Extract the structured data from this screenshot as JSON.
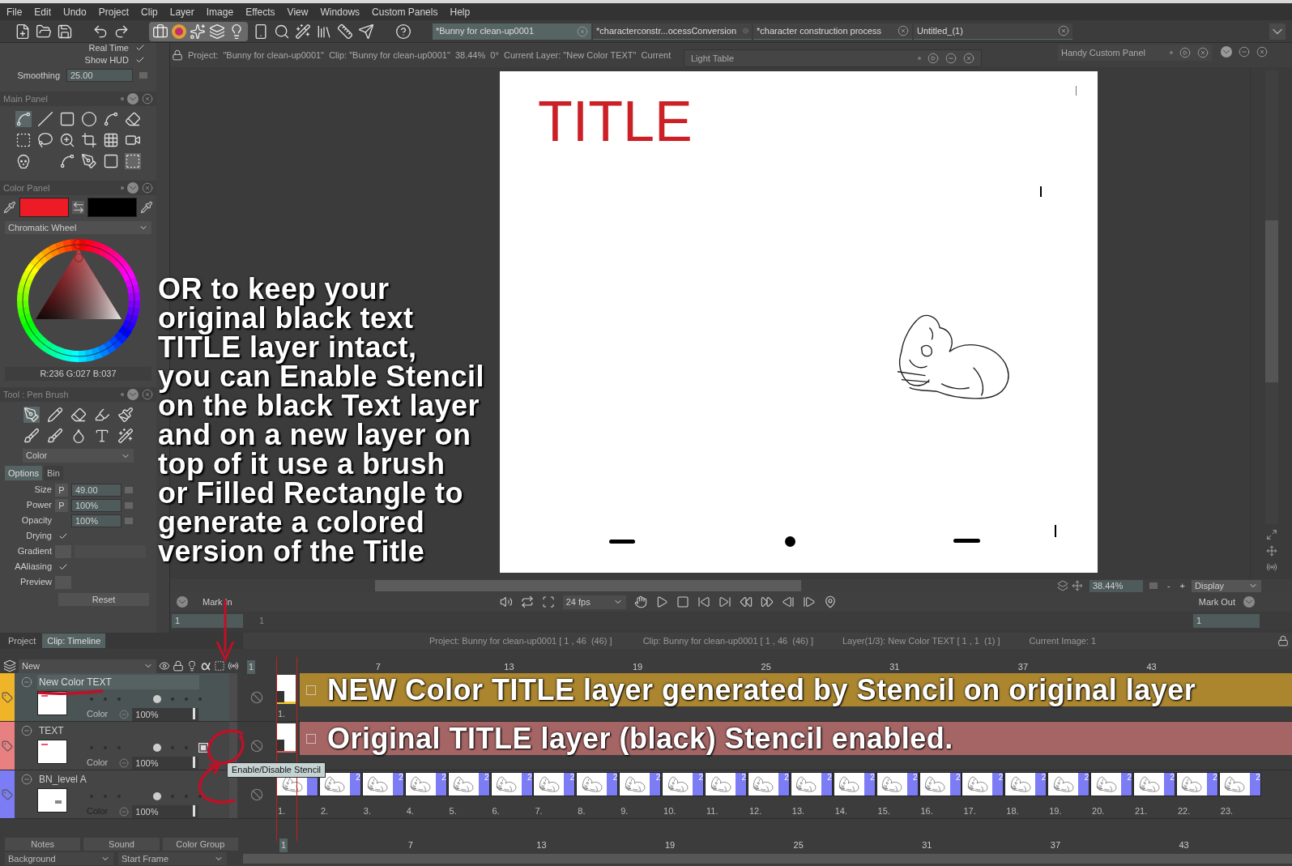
{
  "menu": [
    "File",
    "Edit",
    "Undo",
    "Project",
    "Clip",
    "Layer",
    "Image",
    "Effects",
    "View",
    "Windows",
    "Custom Panels",
    "Help"
  ],
  "project_tabs": [
    {
      "label": "*Bunny for clean-up0001",
      "selected": true
    },
    {
      "label": "*characterconstr...ocessConversion",
      "selected": false
    },
    {
      "label": "*character construction process",
      "selected": false
    },
    {
      "label": "Untitled_(1)",
      "selected": false
    }
  ],
  "info_bar": "Project:  \"Bunny for clean-up0001\"  Clip: \"Bunny for clean-up0001\"  38.44%  0°  Current Layer: \"New Color TEXT\"  Current",
  "light_table": "Light Table",
  "handy_panel": "Handy Custom Panel",
  "tool_options": {
    "rows": [
      {
        "label": "Real Time",
        "checked": true
      },
      {
        "label": "Show HUD",
        "checked": true
      }
    ],
    "smoothing_label": "Smoothing",
    "smoothing_value": "25.00"
  },
  "main_panel": "Main Panel",
  "color_panel": {
    "title": "Color Panel",
    "mode": "Chromatic Wheel",
    "rgb": "R:236 G:027 B:037"
  },
  "tool_panel": {
    "title": "Tool : Pen Brush",
    "mode": "Color",
    "tabs": [
      {
        "label": "Options",
        "selected": true
      },
      {
        "label": "Bin",
        "selected": false
      }
    ],
    "params": [
      {
        "kind": "field",
        "label": "Size",
        "pressure": "P",
        "value": "49.00"
      },
      {
        "kind": "field",
        "label": "Power",
        "pressure": "P",
        "value": "100%"
      },
      {
        "kind": "field",
        "label": "Opacity",
        "value": "100%"
      },
      {
        "kind": "check",
        "label": "Drying",
        "checked": true
      },
      {
        "kind": "gradient",
        "label": "Gradient"
      },
      {
        "kind": "check",
        "label": "AAliasing",
        "checked": true
      },
      {
        "kind": "check",
        "label": "Preview",
        "checked": false
      }
    ],
    "reset": "Reset"
  },
  "canvas": {
    "title": "TITLE"
  },
  "annotation": [
    "OR to keep your",
    "original black text",
    "TITLE layer intact,",
    "you can Enable Stencil",
    "on the black Text layer",
    "and on a new layer on",
    "top of it use a brush",
    "or Filled Rectangle to",
    "generate a colored",
    "version of the Title"
  ],
  "transport": {
    "mark_in": "Mark In",
    "fps": "24 fps",
    "mark_out": "Mark Out",
    "in_value": "1",
    "ruler_label": "1",
    "out_value": "1",
    "zoom": "38.44%",
    "zoom_minus": "-",
    "zoom_plus": "+",
    "display": "Display"
  },
  "timeline": {
    "tabs": [
      {
        "label": "Project",
        "selected": false
      },
      {
        "label": "Clip: Timeline",
        "selected": true
      }
    ],
    "status": [
      "Project: Bunny for clean-up0001 [ 1 , 46  (46) ]",
      "Clip: Bunny for clean-up0001 [ 1 , 46  (46) ]",
      "Layer(1/3): New Color TEXT [ 1 , 1  (1) ]",
      "Current Image: 1"
    ],
    "header": "New",
    "ruler": [
      "1",
      "7",
      "13",
      "19",
      "25",
      "31",
      "37",
      "43"
    ],
    "layers": [
      {
        "name": "New Color TEXT",
        "color": "#f0b428",
        "selected": true,
        "stencil": false,
        "blend": "Color",
        "opacity": "100%",
        "banner": "NEW Color TITLE layer generated by Stencil on original layer",
        "frames": [
          {
            "kind": "title",
            "label": "1."
          }
        ]
      },
      {
        "name": "TEXT",
        "color": "#e87f80",
        "selected": false,
        "stencil": true,
        "blend": "Color",
        "opacity": "100%",
        "banner": "Original TITLE layer (black)  Stencil enabled.",
        "frames": [
          {
            "kind": "title"
          }
        ]
      },
      {
        "name": "BN_level A",
        "color": "#7c7cf4",
        "selected": false,
        "stencil": false,
        "blend": "Color",
        "opacity": "100%",
        "frames": [
          {
            "kind": "sketch",
            "label": "1."
          },
          {
            "kind": "sketch",
            "label": "2.",
            "hold": "2"
          },
          {
            "kind": "sketch",
            "label": "3.",
            "hold": "2"
          },
          {
            "kind": "sketch",
            "label": "4.",
            "hold": "2"
          },
          {
            "kind": "sketch",
            "label": "5.",
            "hold": "2"
          },
          {
            "kind": "sketch",
            "label": "6.",
            "hold": "2"
          },
          {
            "kind": "sketch",
            "label": "7.",
            "hold": "2"
          },
          {
            "kind": "sketch",
            "label": "8.",
            "hold": "2"
          },
          {
            "kind": "sketch",
            "label": "9.",
            "hold": "2"
          },
          {
            "kind": "sketch",
            "label": "10.",
            "hold": "2"
          },
          {
            "kind": "sketch",
            "label": "11.",
            "hold": "2"
          },
          {
            "kind": "sketch",
            "label": "12.",
            "hold": "2"
          },
          {
            "kind": "sketch",
            "label": "13.",
            "hold": "2"
          },
          {
            "kind": "sketch",
            "label": "14.",
            "hold": "2"
          },
          {
            "kind": "sketch",
            "label": "15.",
            "hold": "2"
          },
          {
            "kind": "sketch",
            "label": "16.",
            "hold": "2"
          },
          {
            "kind": "sketch",
            "label": "17.",
            "hold": "2"
          },
          {
            "kind": "sketch",
            "label": "18.",
            "hold": "2"
          },
          {
            "kind": "sketch",
            "label": "19.",
            "hold": "2"
          },
          {
            "kind": "sketch",
            "label": "20.",
            "hold": "2"
          },
          {
            "kind": "sketch",
            "label": "21.",
            "hold": "2"
          },
          {
            "kind": "sketch",
            "label": "22.",
            "hold": "2"
          },
          {
            "kind": "sketch",
            "label": "23.",
            "hold": "2"
          }
        ]
      }
    ],
    "tooltip": "Enable/Disable Stencil",
    "bottom_tabs": [
      "Notes",
      "Sound",
      "Color Group"
    ],
    "bottom_fields": [
      "Background",
      "Start Frame"
    ],
    "bottom_ruler": [
      "1",
      "7",
      "13",
      "19",
      "25",
      "31",
      "37",
      "43"
    ]
  }
}
